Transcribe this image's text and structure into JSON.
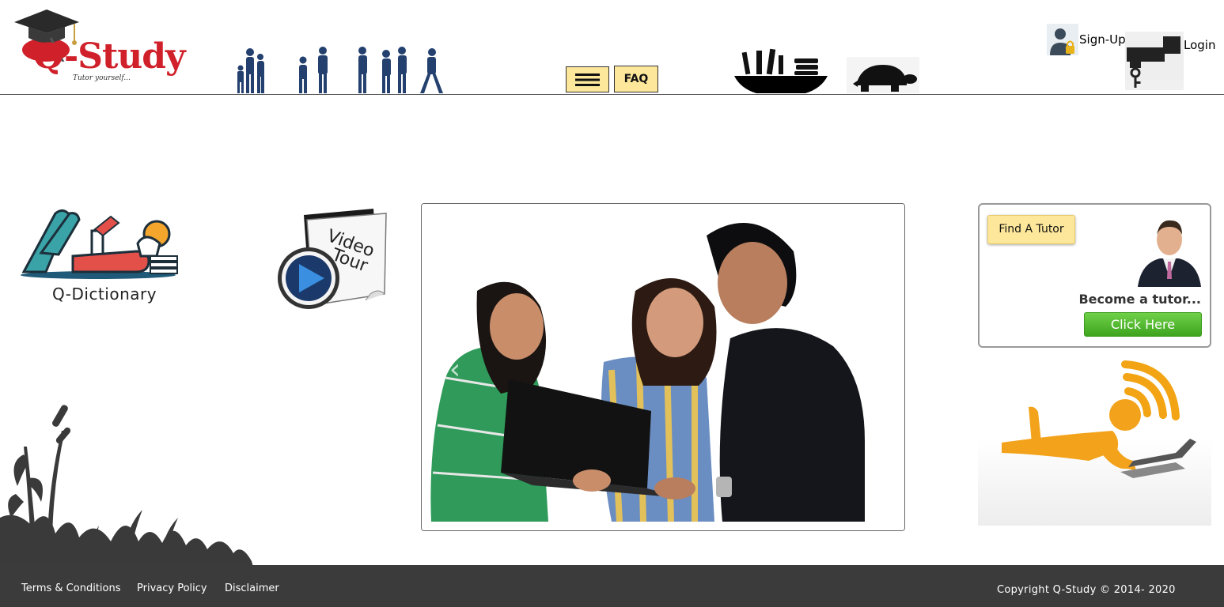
{
  "header": {
    "logo_text": "Q-Study",
    "logo_tagline": "Tutor yourself...",
    "menu_icon": "hamburger-menu-icon",
    "faq_label": "FAQ",
    "decor_icons": [
      "people-silhouettes",
      "bowl-of-books-icon",
      "turtle-icon"
    ],
    "signup_label": "Sign-Up",
    "signup_icon": "user-lock-icon",
    "login_label": "Login",
    "login_icon": "key-icon",
    "button_color": "#fde79a"
  },
  "left": {
    "dictionary_label": "Q-Dictionary",
    "video_tour_label_line1": "Video",
    "video_tour_label_line2": "Tour",
    "video_icon": "play-icon"
  },
  "slider": {
    "image": "students-with-laptop-photo",
    "prev_icon": "chevron-left-icon",
    "next_icon": "chevron-right-icon"
  },
  "tutor_box": {
    "find_tutor_label": "Find A Tutor",
    "become_tutor_label": "Become a tutor...",
    "click_here_label": "Click Here",
    "click_here_color": "#4fb92a"
  },
  "footer": {
    "links": [
      "Terms & Conditions",
      "Privacy Policy",
      "Disclaimer"
    ],
    "copyright": "Copyright Q-Study © 2014- 2020",
    "background": "#3b3b3b"
  }
}
